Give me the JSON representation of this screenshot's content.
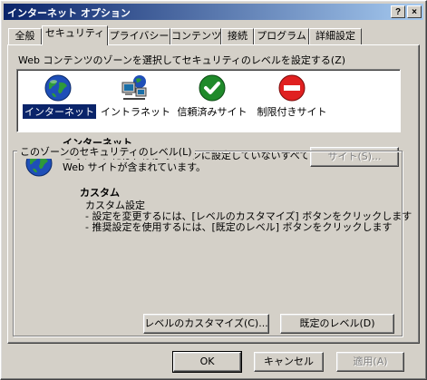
{
  "window": {
    "title": "インターネット オプション",
    "help_button": "?",
    "close_button": "×"
  },
  "tabs": [
    {
      "label": "全般"
    },
    {
      "label": "セキュリティ"
    },
    {
      "label": "プライバシー"
    },
    {
      "label": "コンテンツ"
    },
    {
      "label": "接続"
    },
    {
      "label": "プログラム"
    },
    {
      "label": "詳細設定"
    }
  ],
  "zones": {
    "prompt": "Web コンテンツのゾーンを選択してセキュリティのレベルを設定する(Z)",
    "items": [
      {
        "label": "インターネット",
        "icon": "globe-icon"
      },
      {
        "label": "イントラネット",
        "icon": "network-computer-icon"
      },
      {
        "label": "信頼済みサイト",
        "icon": "checkmark-icon"
      },
      {
        "label": "制限付きサイト",
        "icon": "restricted-icon"
      }
    ]
  },
  "zone_info": {
    "title": "インターネット",
    "desc_line1": "このゾーンには、ほかのゾーンに設定していないすべての",
    "desc_line2": "Web サイトが含まれています。",
    "sites_button": "サイト(S)..."
  },
  "security_level": {
    "group_title": "このゾーンのセキュリティのレベル(L)",
    "level_name": "カスタム",
    "level_desc": "カスタム設定",
    "bullet1": "- 設定を変更するには、[レベルのカスタマイズ] ボタンをクリックします",
    "bullet2": "- 推奨設定を使用するには、[既定のレベル] ボタンをクリックします",
    "customize_button": "レベルのカスタマイズ(C)...",
    "default_button": "既定のレベル(D)"
  },
  "footer": {
    "ok": "OK",
    "cancel": "キャンセル",
    "apply": "適用(A)"
  }
}
